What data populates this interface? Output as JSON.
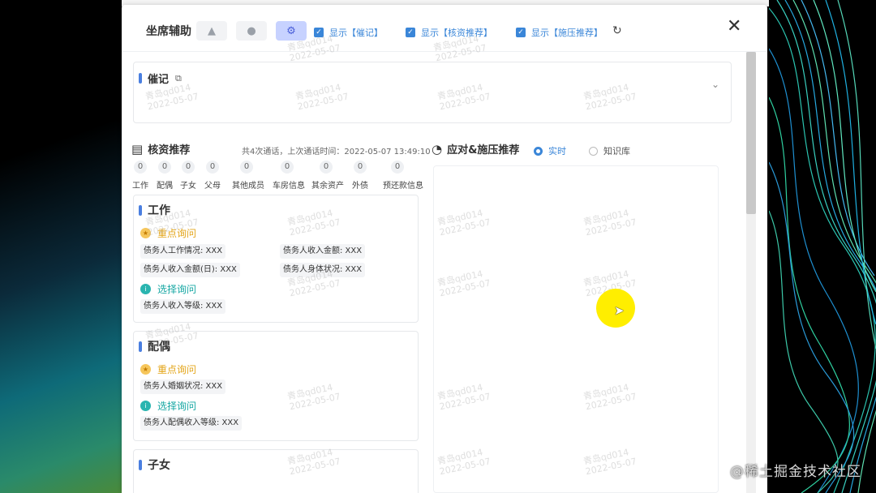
{
  "dialog": {
    "title": "坐席辅助",
    "toolbar": {
      "buttons": [
        {
          "icon": "building-icon",
          "glyph": "▲",
          "active": false
        },
        {
          "icon": "user-icon",
          "glyph": "●",
          "active": false
        },
        {
          "icon": "gear-icon",
          "glyph": "⚙",
          "active": true
        }
      ],
      "checkboxes": [
        {
          "label": "显示【催记】",
          "checked": true
        },
        {
          "label": "显示【核资推荐】",
          "checked": true
        },
        {
          "label": "显示【施压推荐】",
          "checked": true
        }
      ],
      "refresh_glyph": "↻",
      "close_glyph": "✕"
    }
  },
  "cuiji": {
    "title": "催记",
    "copy_glyph": "⧉",
    "chevron_glyph": "⌄"
  },
  "hezi": {
    "title": "核资推荐",
    "stat": "共4次通话，上次通话时间：2022-05-07 13:49:10",
    "counts": [
      {
        "label": "工作",
        "value": "0"
      },
      {
        "label": "配偶",
        "value": "0"
      },
      {
        "label": "子女",
        "value": "0"
      },
      {
        "label": "父母",
        "value": "0"
      },
      {
        "label": "其他成员",
        "value": "0"
      },
      {
        "label": "车房信息",
        "value": "0"
      },
      {
        "label": "其余资产",
        "value": "0"
      },
      {
        "label": "外债",
        "value": "0"
      },
      {
        "label": "预还款信息",
        "value": "0"
      }
    ],
    "cards": [
      {
        "title": "工作",
        "key_label": "重点询问",
        "key_items": [
          "债务人工作情况: XXX",
          "债务人收入金额: XXX",
          "债务人收入金额(日): XXX",
          "债务人身体状况: XXX"
        ],
        "opt_label": "选择询问",
        "opt_items": [
          "债务人收入等级: XXX"
        ]
      },
      {
        "title": "配偶",
        "key_label": "重点询问",
        "key_items": [
          "债务人婚姻状况: XXX"
        ],
        "opt_label": "选择询问",
        "opt_items": [
          "债务人配偶收入等级: XXX"
        ]
      },
      {
        "title": "子女"
      }
    ]
  },
  "pressure": {
    "title": "应对&施压推荐",
    "radio_realtime": "实时",
    "radio_kb": "知识库"
  },
  "watermark": {
    "line1": "青岛qd014",
    "line2": "2022-05-07"
  },
  "corner_watermark": "@稀土掘金技术社区"
}
